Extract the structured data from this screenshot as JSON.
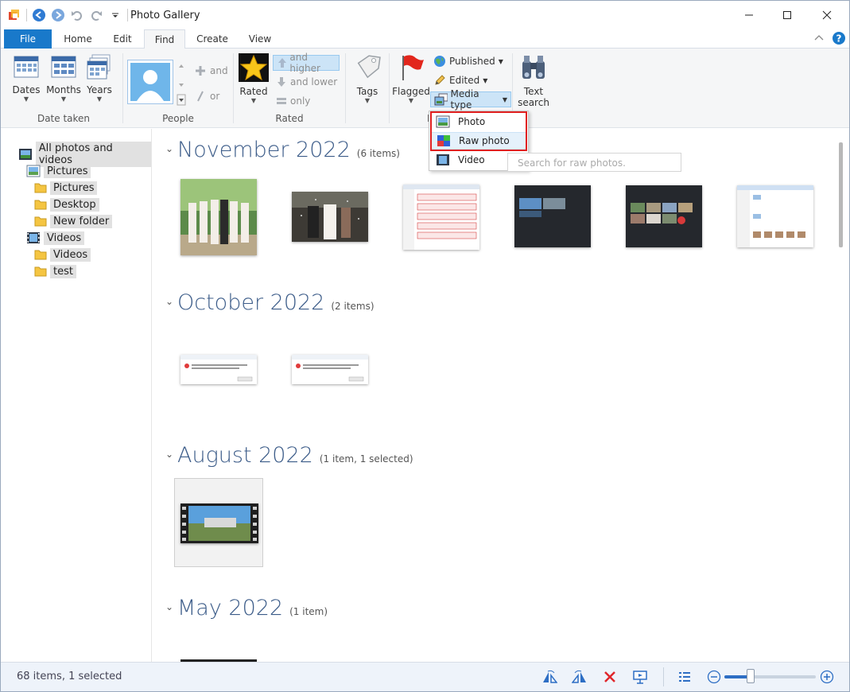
{
  "window": {
    "title": "Photo Gallery"
  },
  "tabs": [
    {
      "label": "File"
    },
    {
      "label": "Home"
    },
    {
      "label": "Edit"
    },
    {
      "label": "Find"
    },
    {
      "label": "Create"
    },
    {
      "label": "View"
    }
  ],
  "ribbon": {
    "date_taken": {
      "label": "Date taken",
      "buttons": [
        "Dates",
        "Months",
        "Years"
      ]
    },
    "people": {
      "label": "People",
      "and": "and",
      "or": "or"
    },
    "rated": {
      "label": "Rated",
      "rated_btn": "Rated",
      "and_higher": "and higher",
      "and_lower": "and lower",
      "only": "only"
    },
    "tags": {
      "label": "Tags"
    },
    "flagged": {
      "label": "Flagged",
      "group_partial": "F"
    },
    "published": "Published",
    "edited": "Edited",
    "media_type": "Media type",
    "text_search": {
      "line1": "Text",
      "line2": "search"
    }
  },
  "dropdown": {
    "items": [
      {
        "label": "Photo"
      },
      {
        "label": "Raw photo"
      },
      {
        "label": "Video"
      }
    ],
    "search_placeholder": "Search for raw photos."
  },
  "nav": {
    "items": [
      {
        "label": "All photos and videos"
      },
      {
        "label": "Pictures"
      },
      {
        "label": "Pictures"
      },
      {
        "label": "Desktop"
      },
      {
        "label": "New folder"
      },
      {
        "label": "Videos"
      },
      {
        "label": "Videos"
      },
      {
        "label": "test"
      }
    ]
  },
  "sections": [
    {
      "title": "November 2022",
      "count": "(6 items)"
    },
    {
      "title": "October 2022",
      "count": "(2 items)"
    },
    {
      "title": "August 2022",
      "count": "(1 item, 1 selected)"
    },
    {
      "title": "May 2022",
      "count": "(1 item)"
    }
  ],
  "status": {
    "text": "68 items, 1 selected"
  },
  "colors": {
    "accent": "#1979ca",
    "section_title": "#3c5c89",
    "highlight_box": "#e02020"
  }
}
